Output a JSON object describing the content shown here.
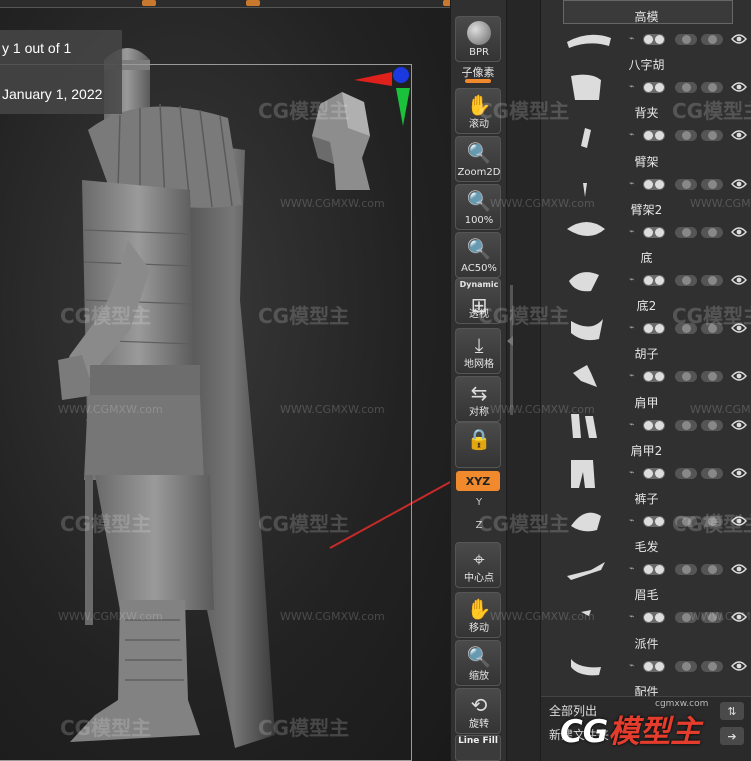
{
  "overlay": {
    "count_text": "y 1 out of 1",
    "date_text": "January 1, 2022"
  },
  "watermark": {
    "brand": "CG模型主",
    "url": "WWW.CGMXW.com",
    "footer_url": "cgmxw.com"
  },
  "toolstrip": {
    "bpr": "BPR",
    "subpixel": "子像素",
    "scroll": "滚动",
    "zoom2d": "Zoom2D",
    "percent100": "100%",
    "ac50": "AC50%",
    "dynamic": "Dynamic",
    "perspective": "透视",
    "floor": "地网格",
    "symmetry": "对称",
    "xyz": "XYZ",
    "y_axis": "Y",
    "z_axis": "Z",
    "center": "中心点",
    "move": "移动",
    "scale": "缩放",
    "rotate": "旋转",
    "linefill": "Line Fill"
  },
  "subtools": [
    {
      "name": "高模"
    },
    {
      "name": "八字胡"
    },
    {
      "name": "背夹"
    },
    {
      "name": "臂架"
    },
    {
      "name": "臂架2"
    },
    {
      "name": "底"
    },
    {
      "name": "底2"
    },
    {
      "name": "胡子"
    },
    {
      "name": "肩甲"
    },
    {
      "name": "肩甲2"
    },
    {
      "name": "裤子"
    },
    {
      "name": "毛发"
    },
    {
      "name": "眉毛"
    },
    {
      "name": "派件"
    },
    {
      "name": "配件"
    }
  ],
  "panel_bottom": {
    "list_all": "全部列出",
    "new_folder": "新建文件夹"
  },
  "colors": {
    "accent": "#f08a2c",
    "arrow": "#c82a2a",
    "axis_x": "#e0201a",
    "axis_y": "#19c23a",
    "axis_z": "#1a3ae0"
  }
}
